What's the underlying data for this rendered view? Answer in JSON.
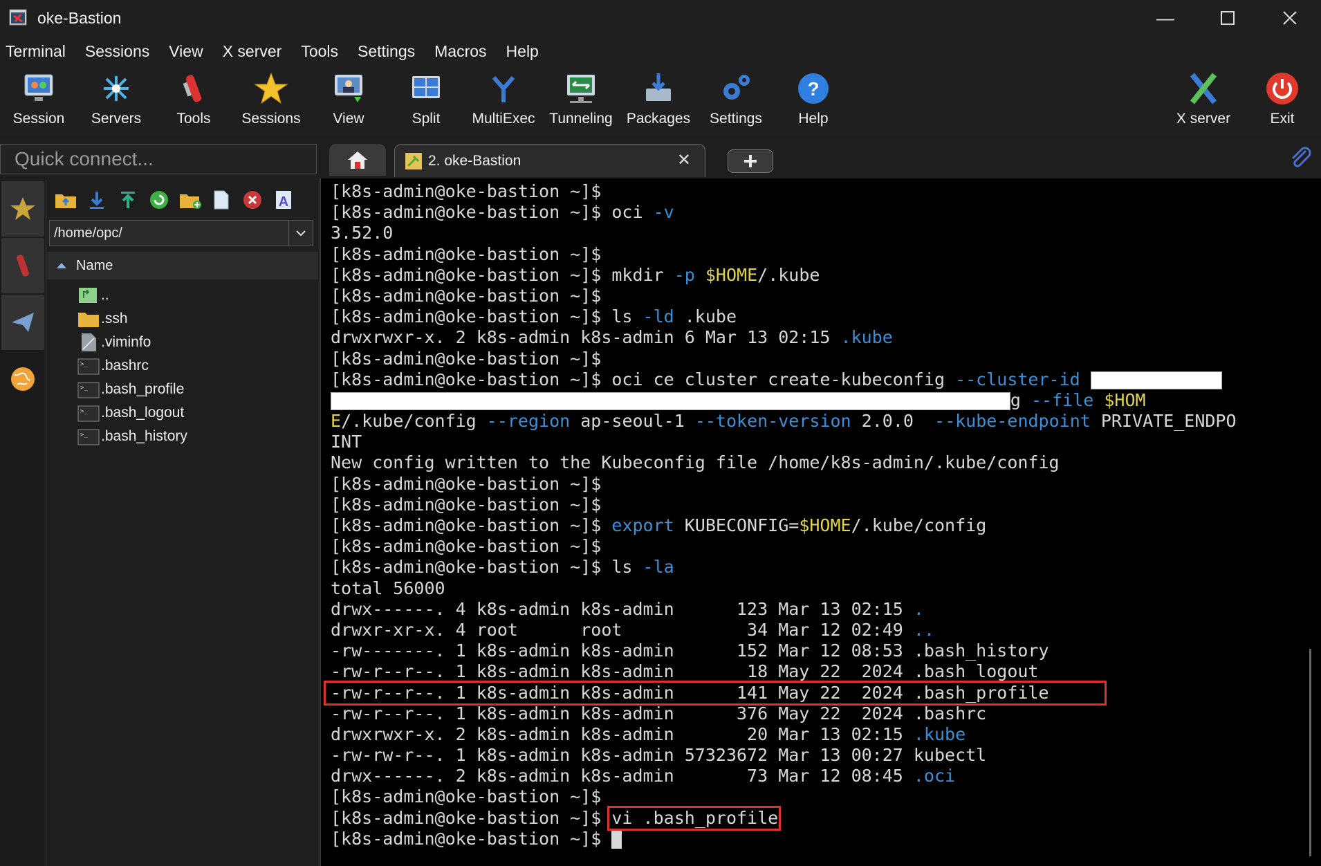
{
  "window": {
    "title": "oke-Bastion"
  },
  "menu": [
    "Terminal",
    "Sessions",
    "View",
    "X server",
    "Tools",
    "Settings",
    "Macros",
    "Help"
  ],
  "toolbar": {
    "items": [
      {
        "label": "Session",
        "icon": "session-icon"
      },
      {
        "label": "Servers",
        "icon": "servers-icon"
      },
      {
        "label": "Tools",
        "icon": "tools-icon"
      },
      {
        "label": "Sessions",
        "icon": "sessions-star-icon"
      },
      {
        "label": "View",
        "icon": "view-icon"
      },
      {
        "label": "Split",
        "icon": "split-icon"
      },
      {
        "label": "MultiExec",
        "icon": "multiexec-icon"
      },
      {
        "label": "Tunneling",
        "icon": "tunneling-icon"
      },
      {
        "label": "Packages",
        "icon": "packages-icon"
      },
      {
        "label": "Settings",
        "icon": "settings-icon"
      },
      {
        "label": "Help",
        "icon": "help-icon"
      }
    ],
    "xserver_label": "X server",
    "exit_label": "Exit"
  },
  "quick_connect": {
    "placeholder": "Quick connect..."
  },
  "tabs": {
    "active_label": "2. oke-Bastion"
  },
  "browser": {
    "path": "/home/opc/",
    "column_header": "Name",
    "files": [
      {
        "name": "..",
        "icon": "parent-folder-icon"
      },
      {
        "name": ".ssh",
        "icon": "folder-icon"
      },
      {
        "name": ".viminfo",
        "icon": "file-icon"
      },
      {
        "name": ".bashrc",
        "icon": "terminal-file-icon"
      },
      {
        "name": ".bash_profile",
        "icon": "terminal-file-icon"
      },
      {
        "name": ".bash_logout",
        "icon": "terminal-file-icon"
      },
      {
        "name": ".bash_history",
        "icon": "terminal-file-icon"
      }
    ]
  },
  "terminal": {
    "prompt": "[k8s-admin@oke-bastion ~]$",
    "lines": [
      {
        "segs": [
          {
            "t": "[k8s-admin@oke-bastion ~]$"
          }
        ]
      },
      {
        "segs": [
          {
            "t": "[k8s-admin@oke-bastion ~]$ oci "
          },
          {
            "t": "-v",
            "c": "c"
          }
        ]
      },
      {
        "segs": [
          {
            "t": "3.52.0"
          }
        ]
      },
      {
        "segs": [
          {
            "t": "[k8s-admin@oke-bastion ~]$"
          }
        ]
      },
      {
        "segs": [
          {
            "t": "[k8s-admin@oke-bastion ~]$ mkdir "
          },
          {
            "t": "-p",
            "c": "c"
          },
          {
            "t": " "
          },
          {
            "t": "$HOME",
            "c": "y"
          },
          {
            "t": "/.kube"
          }
        ]
      },
      {
        "segs": [
          {
            "t": "[k8s-admin@oke-bastion ~]$"
          }
        ]
      },
      {
        "segs": [
          {
            "t": "[k8s-admin@oke-bastion ~]$ ls "
          },
          {
            "t": "-ld",
            "c": "c"
          },
          {
            "t": " .kube"
          }
        ]
      },
      {
        "segs": [
          {
            "t": "drwxrwxr-x. 2 k8s-admin k8s-admin 6 Mar 13 02:15 "
          },
          {
            "t": ".kube",
            "c": "c"
          }
        ]
      },
      {
        "segs": [
          {
            "t": "[k8s-admin@oke-bastion ~]$"
          }
        ]
      },
      {
        "segs": [
          {
            "t": "[k8s-admin@oke-bastion ~]$ oci ce cluster create-kubeconfig "
          },
          {
            "t": "--cluster-id",
            "c": "c"
          },
          {
            "t": " "
          },
          {
            "redact": 7.6
          }
        ]
      },
      {
        "segs": [
          {
            "redact": 39.5
          },
          {
            "t": "g "
          },
          {
            "t": "--file",
            "c": "c"
          },
          {
            "t": " "
          },
          {
            "t": "$HOM",
            "c": "y"
          }
        ]
      },
      {
        "segs": [
          {
            "t": "E",
            "c": "y"
          },
          {
            "t": "/.kube/config "
          },
          {
            "t": "--region",
            "c": "c"
          },
          {
            "t": " ap-seoul-1 "
          },
          {
            "t": "--token-version",
            "c": "c"
          },
          {
            "t": " 2.0.0  "
          },
          {
            "t": "--kube-endpoint",
            "c": "c"
          },
          {
            "t": " PRIVATE_ENDPO"
          }
        ]
      },
      {
        "segs": [
          {
            "t": "INT"
          }
        ]
      },
      {
        "segs": [
          {
            "t": "New config written to the Kubeconfig file /home/k8s-admin/.kube/config"
          }
        ]
      },
      {
        "segs": [
          {
            "t": "[k8s-admin@oke-bastion ~]$"
          }
        ]
      },
      {
        "segs": [
          {
            "t": "[k8s-admin@oke-bastion ~]$"
          }
        ]
      },
      {
        "segs": [
          {
            "t": "[k8s-admin@oke-bastion ~]$ "
          },
          {
            "t": "export",
            "c": "c"
          },
          {
            "t": " KUBECONFIG="
          },
          {
            "t": "$HOME",
            "c": "y"
          },
          {
            "t": "/.kube/config"
          }
        ]
      },
      {
        "segs": [
          {
            "t": "[k8s-admin@oke-bastion ~]$"
          }
        ]
      },
      {
        "segs": [
          {
            "t": "[k8s-admin@oke-bastion ~]$ ls "
          },
          {
            "t": "-la",
            "c": "c"
          }
        ]
      },
      {
        "segs": [
          {
            "t": "total 56000"
          }
        ]
      },
      {
        "segs": [
          {
            "t": "drwx------. 4 k8s-admin k8s-admin      123 Mar 13 02:15 "
          },
          {
            "t": ".",
            "c": "c"
          }
        ]
      },
      {
        "segs": [
          {
            "t": "drwxr-xr-x. 4 root      root            34 Mar 12 02:49 "
          },
          {
            "t": "..",
            "c": "c"
          }
        ]
      },
      {
        "segs": [
          {
            "t": "-rw-------. 1 k8s-admin k8s-admin      152 Mar 12 08:53 .bash_history"
          }
        ]
      },
      {
        "segs": [
          {
            "t": "-rw-r--r--. 1 k8s-admin k8s-admin       18 May 22  2024 .bash_logout"
          }
        ]
      },
      {
        "segs": [
          {
            "t": "-rw-r--r--. 1 k8s-admin k8s-admin      141 May 22  2024 .bash_profile"
          }
        ]
      },
      {
        "segs": [
          {
            "t": "-rw-r--r--. 1 k8s-admin k8s-admin      376 May 22  2024 .bashrc"
          }
        ]
      },
      {
        "segs": [
          {
            "t": "drwxrwxr-x. 2 k8s-admin k8s-admin       20 Mar 13 02:15 "
          },
          {
            "t": ".kube",
            "c": "c"
          }
        ]
      },
      {
        "segs": [
          {
            "t": "-rw-rw-r--. 1 k8s-admin k8s-admin 57323672 Mar 13 00:27 kubectl"
          }
        ]
      },
      {
        "segs": [
          {
            "t": "drwx------. 2 k8s-admin k8s-admin       73 Mar 12 08:45 "
          },
          {
            "t": ".oci",
            "c": "c"
          }
        ]
      },
      {
        "segs": [
          {
            "t": "[k8s-admin@oke-bastion ~]$"
          }
        ]
      },
      {
        "segs": [
          {
            "t": "[k8s-admin@oke-bastion ~]$ vi .bash_profile"
          }
        ]
      },
      {
        "segs": [
          {
            "t": "[k8s-admin@oke-bastion ~]$ "
          },
          {
            "cursor": true
          }
        ]
      }
    ],
    "highlighted_lines": [
      24,
      30
    ]
  },
  "colors": {
    "accent_cyan": "#3d8fd6",
    "accent_yellow": "#e0d24a",
    "highlight_red": "#e0302a"
  }
}
